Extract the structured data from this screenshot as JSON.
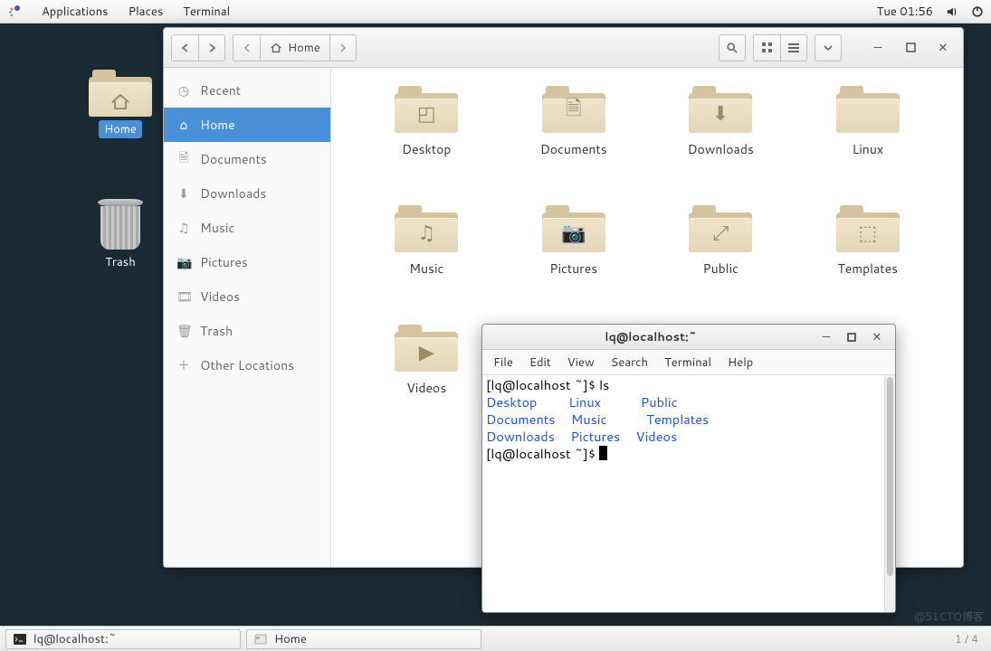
{
  "panel": {
    "applications": "Applications",
    "places": "Places",
    "terminal": "Terminal",
    "clock": "Tue 01:56"
  },
  "desktop": {
    "home_label": "Home",
    "trash_label": "Trash"
  },
  "fm": {
    "path_label": "Home",
    "sidebar": {
      "recent": "Recent",
      "home": "Home",
      "documents": "Documents",
      "downloads": "Downloads",
      "music": "Music",
      "pictures": "Pictures",
      "videos": "Videos",
      "trash": "Trash",
      "other": "Other Locations"
    },
    "items": {
      "desktop": "Desktop",
      "documents": "Documents",
      "downloads": "Downloads",
      "linux": "Linux",
      "music": "Music",
      "pictures": "Pictures",
      "public": "Public",
      "templates": "Templates",
      "videos": "Videos"
    }
  },
  "terminal": {
    "title": "lq@localhost:~",
    "menu": {
      "file": "File",
      "edit": "Edit",
      "view": "View",
      "search": "Search",
      "terminal": "Terminal",
      "help": "Help"
    },
    "prompt1": "[lq@localhost ~]$ ",
    "cmd1": "ls",
    "row1c1": "Desktop",
    "row1c2": "Linux",
    "row1c3": "Public",
    "row2c1": "Documents",
    "row2c2": "Music",
    "row2c3": "Templates",
    "row3c1": "Downloads",
    "row3c2": "Pictures",
    "row3c3": "Videos",
    "prompt2": "[lq@localhost ~]$ "
  },
  "taskbar": {
    "task_terminal": "lq@localhost:~",
    "task_files": "Home",
    "workspace": "1 / 4"
  },
  "watermark": "@51CTO博客"
}
